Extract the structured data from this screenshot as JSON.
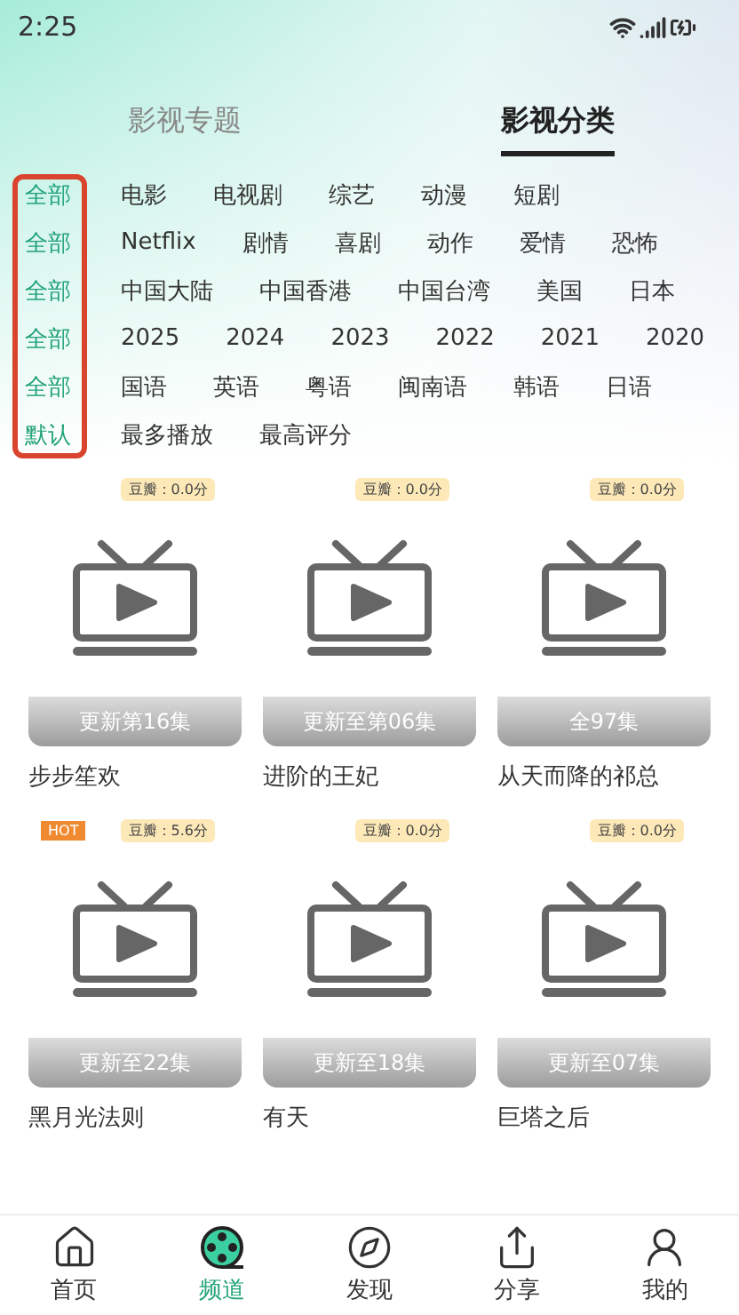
{
  "status_bar": {
    "time": "2:25"
  },
  "tabs": [
    {
      "label": "影视专题",
      "selected": false
    },
    {
      "label": "影视分类",
      "selected": true
    }
  ],
  "filters": [
    {
      "items": [
        {
          "label": "全部",
          "selected": true
        },
        {
          "label": "电影",
          "selected": false
        },
        {
          "label": "电视剧",
          "selected": false
        },
        {
          "label": "综艺",
          "selected": false
        },
        {
          "label": "动漫",
          "selected": false
        },
        {
          "label": "短剧",
          "selected": false
        }
      ]
    },
    {
      "items": [
        {
          "label": "全部",
          "selected": true
        },
        {
          "label": "Netflix",
          "selected": false
        },
        {
          "label": "剧情",
          "selected": false
        },
        {
          "label": "喜剧",
          "selected": false
        },
        {
          "label": "动作",
          "selected": false
        },
        {
          "label": "爱情",
          "selected": false
        },
        {
          "label": "恐怖",
          "selected": false
        }
      ]
    },
    {
      "items": [
        {
          "label": "全部",
          "selected": true
        },
        {
          "label": "中国大陆",
          "selected": false
        },
        {
          "label": "中国香港",
          "selected": false
        },
        {
          "label": "中国台湾",
          "selected": false
        },
        {
          "label": "美国",
          "selected": false
        },
        {
          "label": "日本",
          "selected": false
        }
      ]
    },
    {
      "items": [
        {
          "label": "全部",
          "selected": true
        },
        {
          "label": "2025",
          "selected": false
        },
        {
          "label": "2024",
          "selected": false
        },
        {
          "label": "2023",
          "selected": false
        },
        {
          "label": "2022",
          "selected": false
        },
        {
          "label": "2021",
          "selected": false
        },
        {
          "label": "2020",
          "selected": false
        }
      ]
    },
    {
      "items": [
        {
          "label": "全部",
          "selected": true
        },
        {
          "label": "国语",
          "selected": false
        },
        {
          "label": "英语",
          "selected": false
        },
        {
          "label": "粤语",
          "selected": false
        },
        {
          "label": "闽南语",
          "selected": false
        },
        {
          "label": "韩语",
          "selected": false
        },
        {
          "label": "日语",
          "selected": false
        }
      ]
    },
    {
      "items": [
        {
          "label": "默认",
          "selected": true
        },
        {
          "label": "最多播放",
          "selected": false
        },
        {
          "label": "最高评分",
          "selected": false
        }
      ]
    }
  ],
  "videos": [
    {
      "title": "步步笙欢",
      "score": "豆瓣：0.0分",
      "episodes": "更新第16集"
    },
    {
      "title": "进阶的王妃",
      "score": "豆瓣：0.0分",
      "episodes": "更新至第06集"
    },
    {
      "title": "从天而降的祁总",
      "score": "豆瓣：0.0分",
      "episodes": "全97集"
    },
    {
      "title": "黑月光法则",
      "score": "豆瓣：5.6分",
      "episodes": "更新至22集",
      "hot": "HOT"
    },
    {
      "title": "有天",
      "score": "豆瓣：0.0分",
      "episodes": "更新至18集"
    },
    {
      "title": "巨塔之后",
      "score": "豆瓣：0.0分",
      "episodes": "更新至07集"
    }
  ],
  "nav": [
    {
      "label": "首页",
      "kind": "home",
      "selected": false
    },
    {
      "label": "频道",
      "kind": "channel",
      "selected": true
    },
    {
      "label": "发现",
      "kind": "discover",
      "selected": false
    },
    {
      "label": "分享",
      "kind": "share",
      "selected": false
    },
    {
      "label": "我的",
      "kind": "me",
      "selected": false
    }
  ]
}
